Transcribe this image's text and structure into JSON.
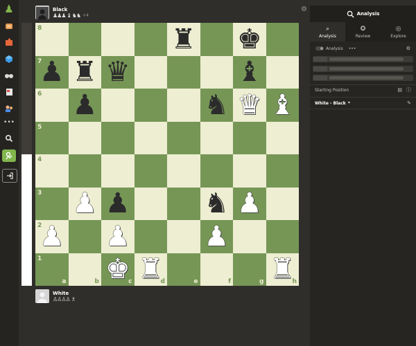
{
  "nav": {
    "items": [
      "pawn-logo-icon",
      "play-icon",
      "puzzles-icon",
      "learn-icon",
      "watch-icon",
      "news-icon",
      "social-icon",
      "more-icon",
      "search-icon",
      "analysis-icon",
      "exit-icon"
    ],
    "more_glyph": "•••"
  },
  "top_player": {
    "name": "Black",
    "captured": "♟♟♟ ♝ ♞♞",
    "advantage": "+4"
  },
  "bottom_player": {
    "name": "White",
    "captured": "♙♙♙♙ ♗"
  },
  "eval": {
    "white_fraction": 0.5
  },
  "board": {
    "ranks": [
      "8",
      "7",
      "6",
      "5",
      "4",
      "3",
      "2",
      "1"
    ],
    "files": [
      "a",
      "b",
      "c",
      "d",
      "e",
      "f",
      "g",
      "h"
    ],
    "rows": [
      [
        "",
        "",
        "",
        "",
        "r",
        "",
        "k",
        ""
      ],
      [
        "p",
        "r",
        "q",
        "",
        "",
        "",
        "b",
        ""
      ],
      [
        "",
        "p",
        "",
        "",
        "",
        "n",
        "Q",
        "B"
      ],
      [
        "",
        "",
        "",
        "",
        "",
        "",
        "",
        ""
      ],
      [
        "",
        "",
        "",
        "",
        "",
        "",
        "",
        ""
      ],
      [
        "",
        "P",
        "p",
        "",
        "",
        "n",
        "P",
        ""
      ],
      [
        "P",
        "",
        "P",
        "",
        "",
        "P",
        "",
        ""
      ],
      [
        "",
        "",
        "K",
        "R",
        "",
        "",
        "",
        "R"
      ]
    ]
  },
  "panel": {
    "title": "Analysis",
    "tabs": [
      {
        "label": "Analysis",
        "icon": "analysis-tab-icon"
      },
      {
        "label": "Review",
        "icon": "review-tab-icon"
      },
      {
        "label": "Explore",
        "icon": "explore-tab-icon"
      }
    ],
    "engine_label": "Analysis",
    "engine_more": "•••",
    "starting_position": "Starting Position",
    "game_label": "White - Black",
    "game_star": "*"
  },
  "colors": {
    "light": "#eeeed2",
    "dark": "#769656",
    "bg": "#302e2b",
    "panel": "#262522"
  }
}
